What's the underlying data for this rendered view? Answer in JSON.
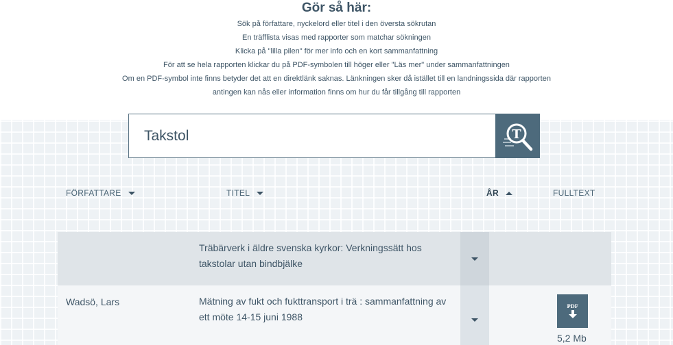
{
  "instructions": {
    "title": "Gör så här:",
    "lines": [
      "Sök på författare, nyckelord eller titel i den översta sökrutan",
      "En träfflista visas med rapporter som matchar sökningen",
      "Klicka på \"lilla pilen\" för mer info och en kort sammanfattning",
      "För att se hela rapporten klickar du på PDF-symbolen till höger eller \"Läs mer\" under sammanfattningen",
      "Om en PDF-symbol inte finns betyder det att en direktlänk saknas. Länkningen sker då istället till en landningssida där rapporten",
      "antingen kan nås eller information finns om hur du får tillgång till rapporten"
    ]
  },
  "search": {
    "value": "Takstol",
    "button_icon": "search-magnifier-icon"
  },
  "columns": {
    "author": "FÖRFATTARE",
    "title": "TITEL",
    "year": "ÅR",
    "fulltext": "FULLTEXT"
  },
  "rows": [
    {
      "author": "",
      "title": "Träbärverk i äldre svenska kyrkor: Verkningssätt hos takstolar utan bindbjälke",
      "year": "",
      "has_pdf": false
    },
    {
      "author": "Wadsö, Lars",
      "title": "Mätning av fukt och fukttransport i trä : sammanfattning av ett möte 14-15 juni 1988",
      "year": "",
      "has_pdf": true,
      "pdf_label": "PDF",
      "file_size": "5,2 Mb"
    }
  ],
  "colors": {
    "accent": "#4d6a7c",
    "text": "#3e5566",
    "row_alt": "#dfe4e8"
  }
}
